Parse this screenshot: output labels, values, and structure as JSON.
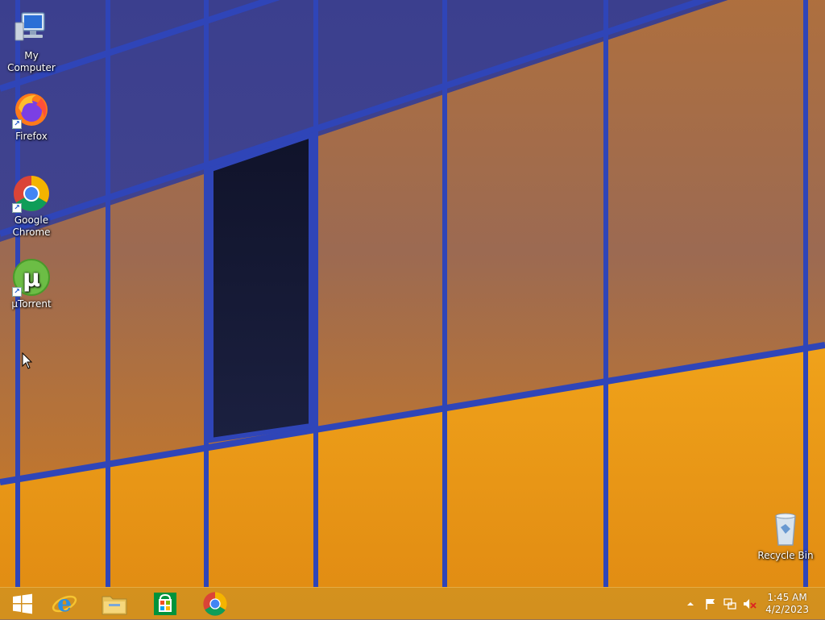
{
  "desktop": {
    "icons": [
      {
        "label": "My Computer",
        "icon": "computer-icon",
        "shortcut": false
      },
      {
        "label": "Firefox",
        "icon": "firefox-icon",
        "shortcut": true
      },
      {
        "label": "Google\nChrome",
        "icon": "chrome-icon",
        "shortcut": true
      },
      {
        "label": "µTorrent",
        "icon": "utorrent-icon",
        "shortcut": true
      }
    ],
    "recycle_bin": {
      "label": "Recycle Bin",
      "icon": "recycle-bin-icon"
    }
  },
  "taskbar": {
    "buttons": [
      {
        "name": "start",
        "icon": "windows-logo-icon"
      },
      {
        "name": "internet-explorer",
        "icon": "internet-explorer-icon"
      },
      {
        "name": "file-explorer",
        "icon": "folder-icon"
      },
      {
        "name": "store",
        "icon": "store-icon"
      },
      {
        "name": "chrome",
        "icon": "chrome-icon"
      }
    ],
    "tray": {
      "icons": [
        "show-hidden-icons-chevron-icon",
        "action-center-flag-icon",
        "network-icon",
        "volume-muted-icon"
      ]
    },
    "clock": {
      "time": "1:45 AM",
      "date": "4/2/2023"
    }
  },
  "colors": {
    "panel_blue": "#2f45b8",
    "glass_orange": "#e89a1a",
    "taskbar_tint": "#c89628"
  }
}
